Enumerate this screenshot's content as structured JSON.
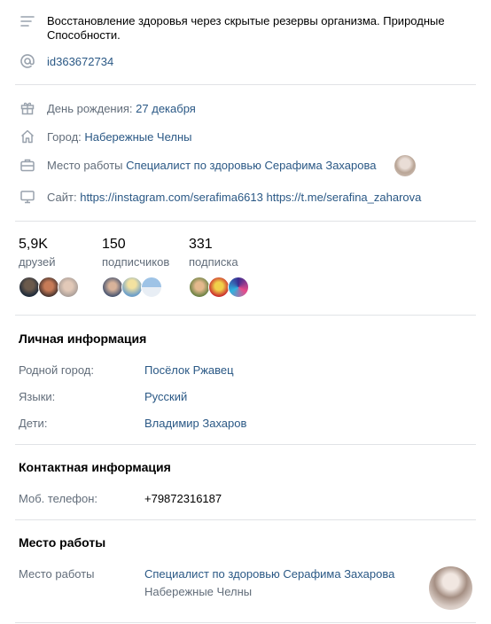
{
  "status": {
    "text": "Восстановление здоровья через скрытые резервы организма. Природные Способности.",
    "short_id": "id363672734"
  },
  "details": {
    "birthday_label": "День рождения:",
    "birthday_value": "27 декабря",
    "city_label": "Город:",
    "city_value": "Набережные Челны",
    "work_label": "Место работы",
    "work_value": "Специалист по здоровью Серафима Захарова",
    "site_label": "Сайт:",
    "site_link1": "https://instagram.com/serafima6613",
    "site_link2": "https://t.me/serafina_zaharova"
  },
  "stats": [
    {
      "count": "5,9K",
      "label": "друзей"
    },
    {
      "count": "150",
      "label": "подписчиков"
    },
    {
      "count": "331",
      "label": "подписка"
    }
  ],
  "personal": {
    "title": "Личная информация",
    "rows": [
      {
        "label": "Родной город:",
        "value": "Посёлок Ржавец"
      },
      {
        "label": "Языки:",
        "value": "Русский"
      },
      {
        "label": "Дети:",
        "value": "Владимир Захаров"
      }
    ]
  },
  "contact": {
    "title": "Контактная информация",
    "phone_label": "Моб. телефон:",
    "phone_value": "+79872316187"
  },
  "job": {
    "title": "Место работы",
    "label": "Место работы",
    "company": "Специалист по здоровью Серафима Захарова",
    "city": "Набережные Челны"
  },
  "colors": {
    "link": "#2a5885",
    "muted": "#626d7a",
    "separator": "#e1e3e6",
    "icon": "#99a2ad"
  }
}
